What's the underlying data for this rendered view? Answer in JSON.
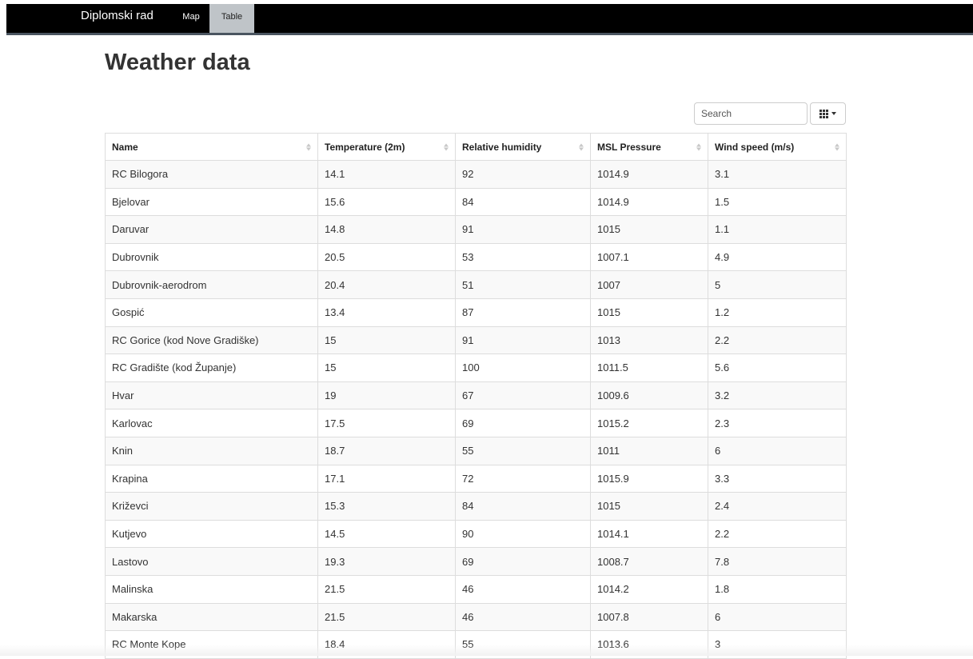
{
  "navbar": {
    "brand": "Diplomski rad",
    "links": [
      {
        "label": "Map",
        "active": false
      },
      {
        "label": "Table",
        "active": true
      }
    ]
  },
  "page": {
    "title": "Weather data"
  },
  "toolbar": {
    "search_placeholder": "Search",
    "columns_icon": "grid-icon",
    "columns_caret_icon": "caret-down-icon"
  },
  "table": {
    "columns": [
      "Name",
      "Temperature (2m)",
      "Relative humidity",
      "MSL Pressure",
      "Wind speed (m/s)"
    ],
    "sort_icon": "sort-both-icon",
    "rows": [
      [
        "RC Bilogora",
        "14.1",
        "92",
        "1014.9",
        "3.1"
      ],
      [
        "Bjelovar",
        "15.6",
        "84",
        "1014.9",
        "1.5"
      ],
      [
        "Daruvar",
        "14.8",
        "91",
        "1015",
        "1.1"
      ],
      [
        "Dubrovnik",
        "20.5",
        "53",
        "1007.1",
        "4.9"
      ],
      [
        "Dubrovnik-aerodrom",
        "20.4",
        "51",
        "1007",
        "5"
      ],
      [
        "Gospić",
        "13.4",
        "87",
        "1015",
        "1.2"
      ],
      [
        "RC Gorice (kod Nove Gradiške)",
        "15",
        "91",
        "1013",
        "2.2"
      ],
      [
        "RC Gradište (kod Županje)",
        "15",
        "100",
        "1011.5",
        "5.6"
      ],
      [
        "Hvar",
        "19",
        "67",
        "1009.6",
        "3.2"
      ],
      [
        "Karlovac",
        "17.5",
        "69",
        "1015.2",
        "2.3"
      ],
      [
        "Knin",
        "18.7",
        "55",
        "1011",
        "6"
      ],
      [
        "Krapina",
        "17.1",
        "72",
        "1015.9",
        "3.3"
      ],
      [
        "Križevci",
        "15.3",
        "84",
        "1015",
        "2.4"
      ],
      [
        "Kutjevo",
        "14.5",
        "90",
        "1014.1",
        "2.2"
      ],
      [
        "Lastovo",
        "19.3",
        "69",
        "1008.7",
        "7.8"
      ],
      [
        "Malinska",
        "21.5",
        "46",
        "1014.2",
        "1.8"
      ],
      [
        "Makarska",
        "21.5",
        "46",
        "1007.8",
        "6"
      ],
      [
        "RC Monte Kope",
        "18.4",
        "55",
        "1013.6",
        "3"
      ]
    ]
  }
}
